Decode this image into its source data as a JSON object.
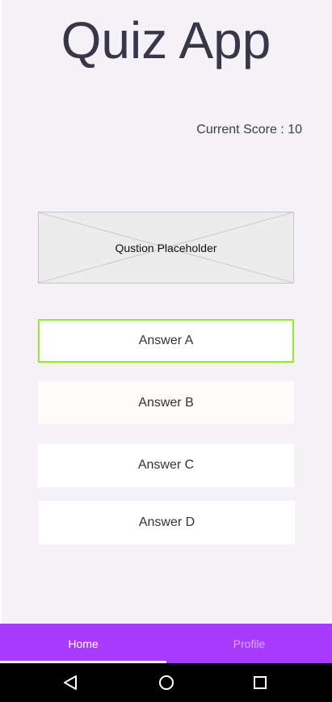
{
  "app": {
    "title": "Quiz App"
  },
  "score": {
    "text": "Current Score : 10"
  },
  "question": {
    "placeholder": "Qustion Placeholder"
  },
  "answers": [
    {
      "label": "Answer A",
      "selected": true
    },
    {
      "label": "Answer B"
    },
    {
      "label": "Answer C"
    },
    {
      "label": "Answer D"
    }
  ],
  "bottom_nav": {
    "items": [
      {
        "label": "Home",
        "active": true
      },
      {
        "label": "Profile",
        "active": false
      }
    ]
  },
  "system_nav": {
    "buttons": [
      "back-icon",
      "home-icon",
      "recents-icon"
    ]
  },
  "colors": {
    "background": "#f4f1f7",
    "accent": "#a93bff",
    "selected_border": "#96e82b",
    "title": "#3a3649"
  }
}
